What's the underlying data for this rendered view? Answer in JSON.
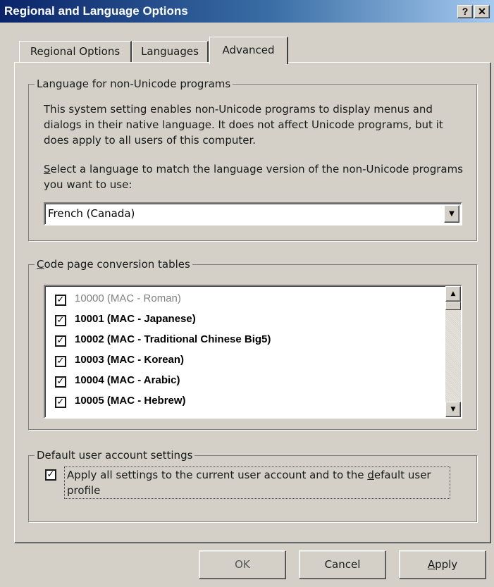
{
  "window": {
    "title": "Regional and Language Options",
    "help_glyph": "?",
    "close_glyph": "✕"
  },
  "tabs": [
    {
      "label": "Regional Options"
    },
    {
      "label": "Languages"
    },
    {
      "label": "Advanced",
      "selected": true
    }
  ],
  "non_unicode": {
    "legend": "Language for non-Unicode programs",
    "description": "This system setting enables non-Unicode programs to display menus and dialogs in their native language. It does not affect Unicode programs, but it does apply to all users of this computer.",
    "prompt_prefix": "S",
    "prompt_rest": "elect a language to match the language version of the non-Unicode programs you want to use:",
    "selected_language": "French (Canada)"
  },
  "code_page": {
    "legend_prefix": "C",
    "legend_rest": "ode page conversion tables",
    "items": [
      {
        "label": "10000 (MAC - Roman)",
        "checked": true,
        "style": "dim"
      },
      {
        "label": "10001 (MAC - Japanese)",
        "checked": true,
        "style": "bold"
      },
      {
        "label": "10002 (MAC - Traditional Chinese Big5)",
        "checked": true,
        "style": "bold"
      },
      {
        "label": "10003 (MAC - Korean)",
        "checked": true,
        "style": "bold"
      },
      {
        "label": "10004 (MAC - Arabic)",
        "checked": true,
        "style": "bold"
      },
      {
        "label": "10005 (MAC - Hebrew)",
        "checked": true,
        "style": "bold"
      }
    ]
  },
  "default_account": {
    "legend": "Default user account settings",
    "checkbox_label_part1": "Apply all settings to the current user account and to the ",
    "checkbox_label_accel": "d",
    "checkbox_label_part2": "efault user profile",
    "checked": true
  },
  "buttons": {
    "ok": "OK",
    "cancel": "Cancel",
    "apply_accel": "A",
    "apply_rest": "pply"
  },
  "glyphs": {
    "check": "✓",
    "dropdown": "▼",
    "scroll_up": "▲",
    "scroll_down": "▼"
  },
  "colors": {
    "dialog_face": "#d4d0c8",
    "title_start": "#0a246a",
    "title_end": "#a6caf0"
  }
}
